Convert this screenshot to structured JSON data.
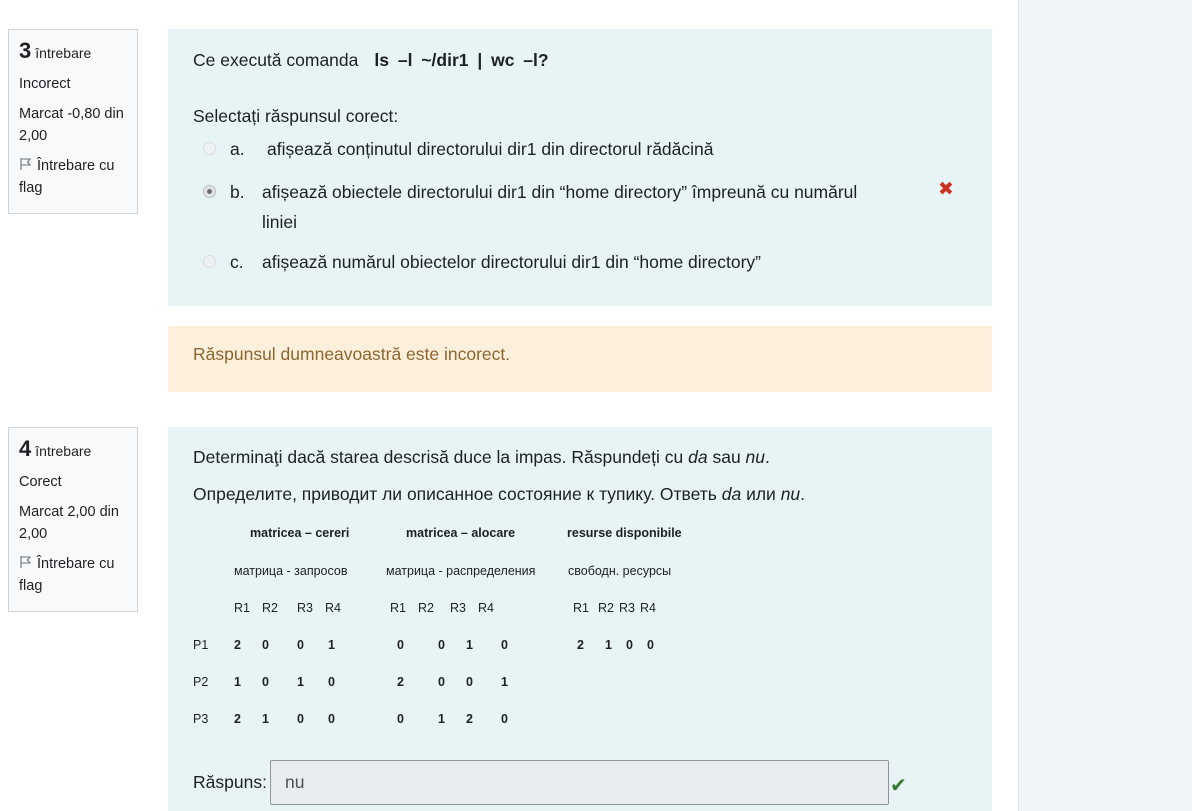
{
  "q3": {
    "number": "3",
    "word": "întrebare",
    "status": "Incorect",
    "mark": "Marcat -0,80 din 2,00",
    "flag_label": "Întrebare cu flag",
    "prompt": "Ce execută comanda",
    "command": "ls –l ~/dir1 | wc –l?",
    "select_label": "Selectați răspunsul corect:",
    "options": [
      {
        "letter": "a.",
        "text": "afișează conținutul directorului dir1  din directorul rădăcină",
        "selected": false
      },
      {
        "letter": "b.",
        "text_line1": "afișează obiectele directorului dir1  din “home directory” împreună cu numărul",
        "text_line2": "liniei",
        "selected": true
      },
      {
        "letter": "c.",
        "text": "afișează numărul obiectelor directorului dir1  din “home directory”",
        "selected": false
      }
    ],
    "wrong_icon": "✖",
    "feedback": "Răspunsul dumneavoastră este incorect."
  },
  "q4": {
    "number": "4",
    "word": "întrebare",
    "status": "Corect",
    "mark": "Marcat 2,00 din 2,00",
    "flag_label": "Întrebare cu flag",
    "text_ro_pre": "Determinaţi dacă starea descrisă duce la impas. Răspundeți cu ",
    "text_ro_da": "da",
    "text_ro_mid": " sau ",
    "text_ro_nu": "nu",
    "text_ru_pre": "Определите, приводит ли описанное состояние к тупику. Ответь ",
    "text_ru_da": "da",
    "text_ru_mid": " или ",
    "text_ru_nu": "nu",
    "table": {
      "h1": "matricea – cereri",
      "h2": "matricea – alocare",
      "h3": "resurse disponibile",
      "s1": "матрица - запросов",
      "s2": "матрица - распределения",
      "s3": "свободн. ресурсы",
      "cols": [
        "R1",
        "R2",
        "R3",
        "R4"
      ],
      "rows": [
        {
          "p": "P1",
          "req": [
            "2",
            "0",
            "0",
            "1"
          ],
          "alloc": [
            "0",
            "0",
            "1",
            "0"
          ],
          "avail": [
            "2",
            "1",
            "0",
            "0"
          ]
        },
        {
          "p": "P2",
          "req": [
            "1",
            "0",
            "1",
            "0"
          ],
          "alloc": [
            "2",
            "0",
            "0",
            "1"
          ]
        },
        {
          "p": "P3",
          "req": [
            "2",
            "1",
            "0",
            "0"
          ],
          "alloc": [
            "0",
            "1",
            "2",
            "0"
          ]
        }
      ]
    },
    "answer_label": "Răspuns:",
    "answer_value": "nu",
    "correct_icon": "✔"
  }
}
